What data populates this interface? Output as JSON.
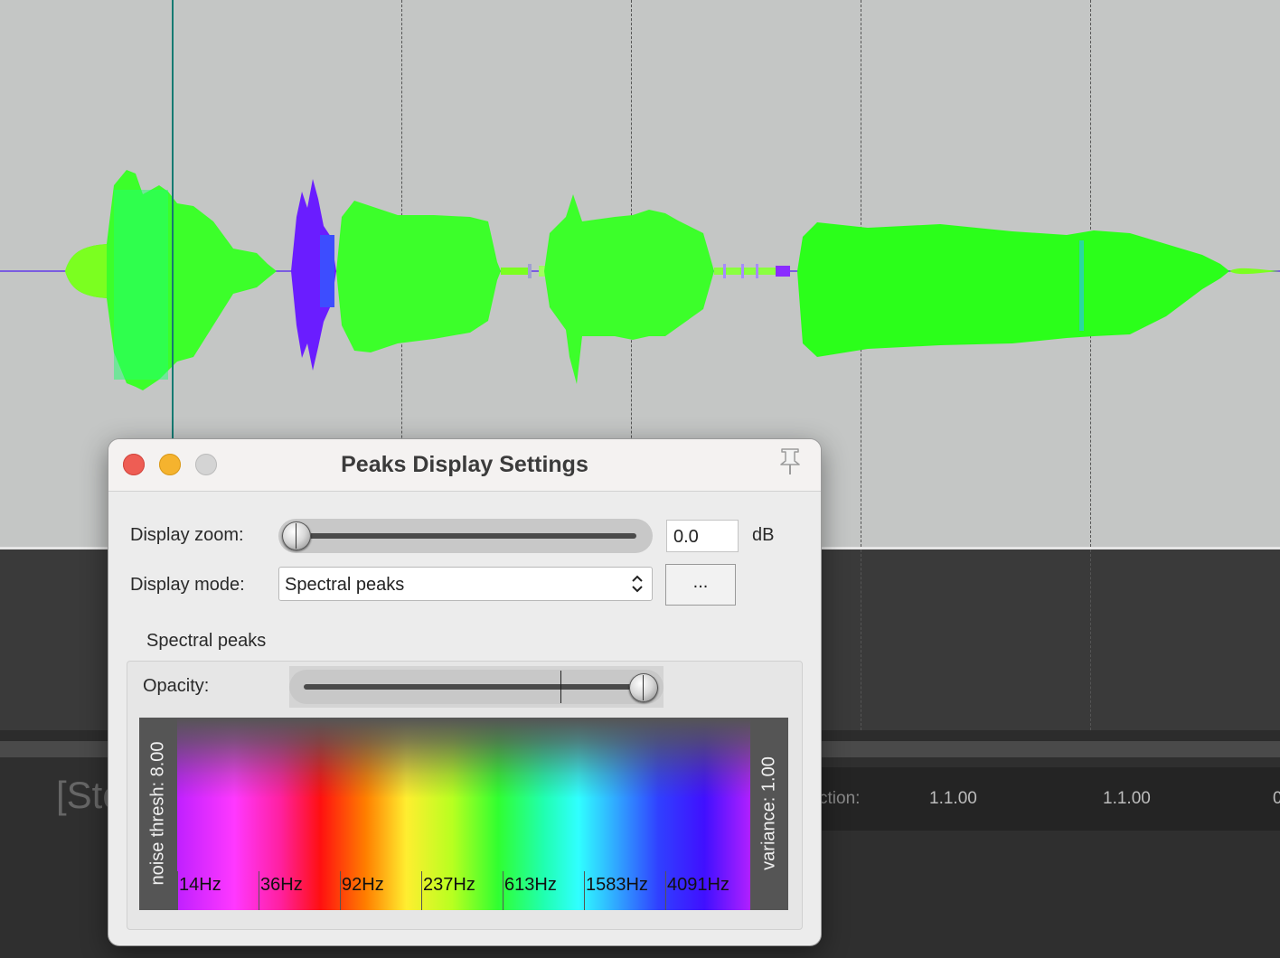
{
  "dialog": {
    "title": "Peaks Display Settings",
    "zoom_label": "Display zoom:",
    "zoom_value": "0.0",
    "zoom_unit": "dB",
    "zoom_slider_level": 0.0,
    "mode_label": "Display mode:",
    "mode_value": "Spectral peaks",
    "more_button": "...",
    "section_title": "Spectral peaks",
    "opacity_label": "Opacity:",
    "opacity_level": 1.0,
    "noise_thresh": "noise thresh: 8.00",
    "variance": "variance: 1.00",
    "frequencies": [
      "14Hz",
      "36Hz",
      "92Hz",
      "237Hz",
      "613Hz",
      "1583Hz",
      "4091Hz"
    ]
  },
  "background": {
    "status_text": "[Sto",
    "position_label": "ction:",
    "position_values": [
      "1.1.00",
      "1.1.00",
      "0"
    ]
  },
  "icons": [
    "close-icon",
    "minimize-icon",
    "zoom-icon",
    "pin-icon",
    "updown-arrows-icon"
  ],
  "colors": {
    "arrange_bg": "#c4c6c5",
    "waveform_green": "#3cff2a",
    "waveform_purple": "#6a1dff",
    "playhead": "#157a72",
    "close": "#ee5d54",
    "minimize": "#f5b32e"
  }
}
